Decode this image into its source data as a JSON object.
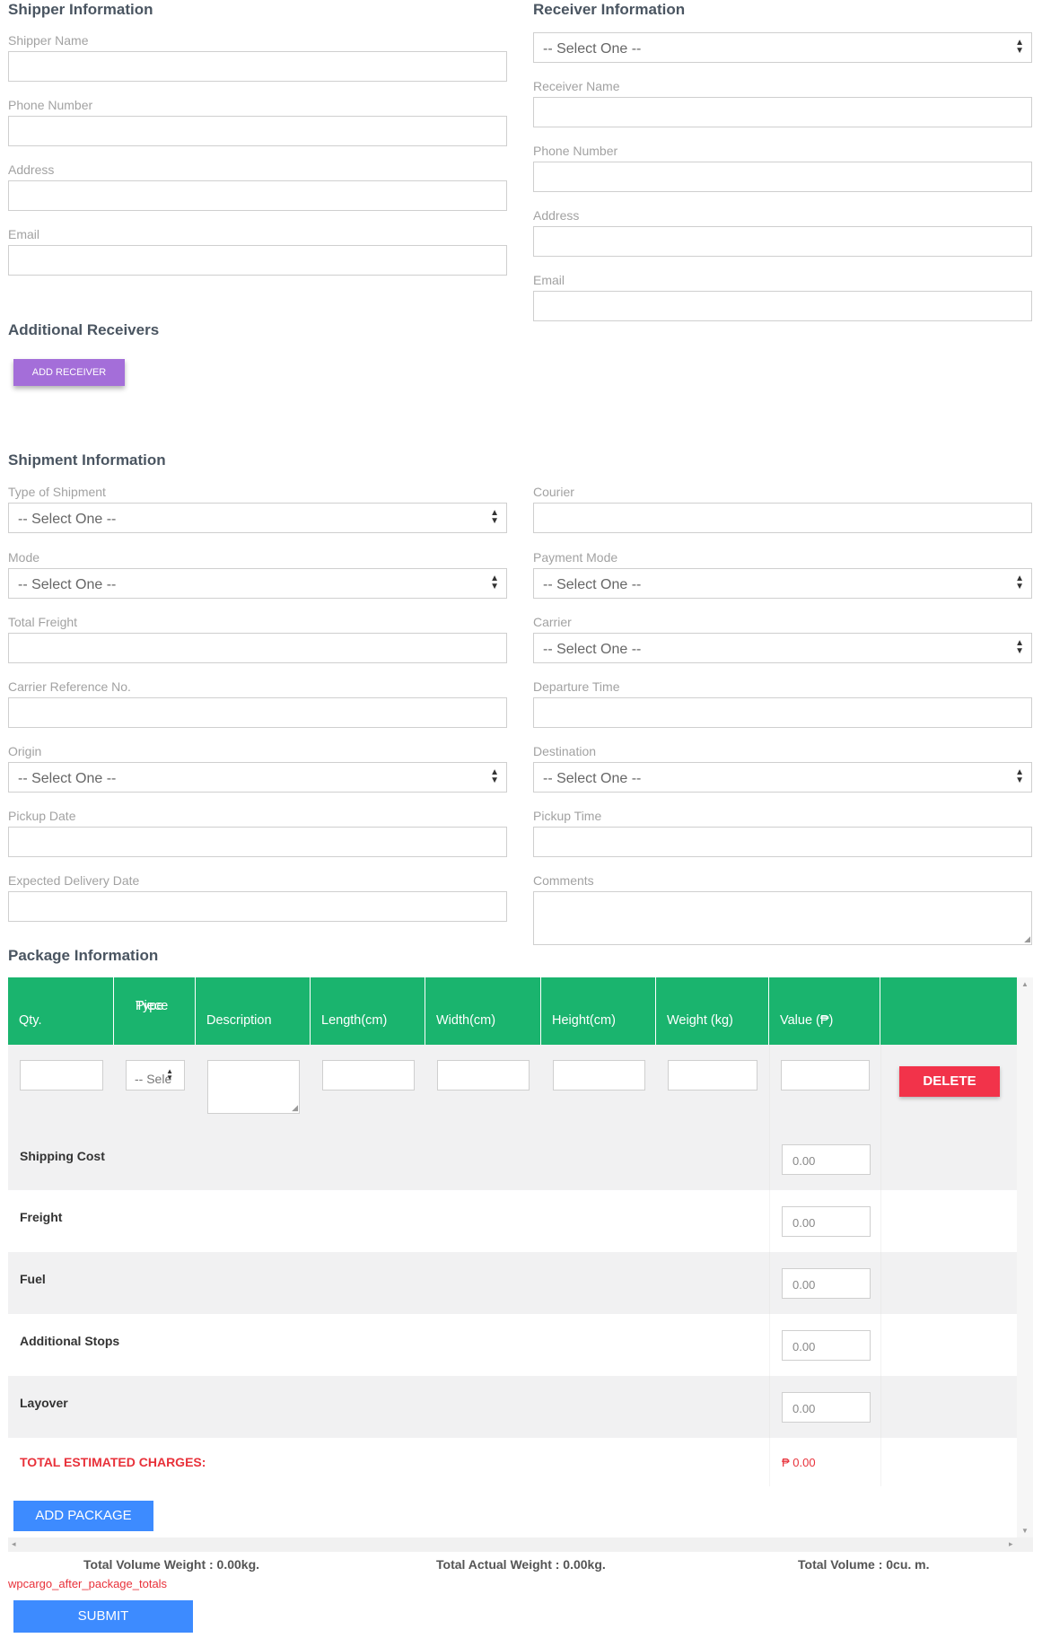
{
  "shipper": {
    "title": "Shipper Information",
    "name_label": "Shipper Name",
    "phone_label": "Phone Number",
    "address_label": "Address",
    "email_label": "Email"
  },
  "receiver": {
    "title": "Receiver Information",
    "select_value": "-- Select One --",
    "name_label": "Receiver Name",
    "phone_label": "Phone Number",
    "address_label": "Address",
    "email_label": "Email"
  },
  "additional": {
    "title": "Additional Receivers",
    "add_button": "ADD RECEIVER"
  },
  "shipment": {
    "title": "Shipment Information",
    "type_label": "Type of Shipment",
    "courier_label": "Courier",
    "mode_label": "Mode",
    "payment_label": "Payment Mode",
    "freight_label": "Total Freight",
    "carrier_label": "Carrier",
    "carrier_ref_label": "Carrier Reference No.",
    "departure_label": "Departure Time",
    "origin_label": "Origin",
    "destination_label": "Destination",
    "pickup_date_label": "Pickup Date",
    "pickup_time_label": "Pickup Time",
    "delivery_label": "Expected Delivery Date",
    "comments_label": "Comments",
    "select_value": "-- Select One --"
  },
  "package": {
    "title": "Package Information",
    "header_color": "#1ab46e",
    "columns": {
      "qty": "Qty.",
      "piece_1": "Piece",
      "piece_2": "Type",
      "description": "Description",
      "length": "Length(cm)",
      "width": "Width(cm)",
      "height": "Height(cm)",
      "weight": "Weight (kg)",
      "value": "Value (₱)"
    },
    "piece_select": "-- Sele",
    "delete_button": "DELETE",
    "delete_color": "#f2334a",
    "rows": {
      "shipping": {
        "label": "Shipping Cost",
        "value": "0.00"
      },
      "freight": {
        "label": "Freight",
        "value": "0.00"
      },
      "fuel": {
        "label": "Fuel",
        "value": "0.00"
      },
      "stops": {
        "label": "Additional Stops",
        "value": "0.00"
      },
      "layover": {
        "label": "Layover",
        "value": "0.00"
      }
    },
    "total_label": "TOTAL ESTIMATED CHARGES:",
    "total_value": "₱ 0.00",
    "total_color": "#e8313a",
    "add_button": "ADD PACKAGE"
  },
  "totals": {
    "volume_weight": "Total Volume Weight : 0.00kg.",
    "actual_weight": "Total Actual Weight : 0.00kg.",
    "volume": "Total Volume : 0cu. m."
  },
  "hook_text": "wpcargo_after_package_totals",
  "submit_button": "SUBMIT"
}
